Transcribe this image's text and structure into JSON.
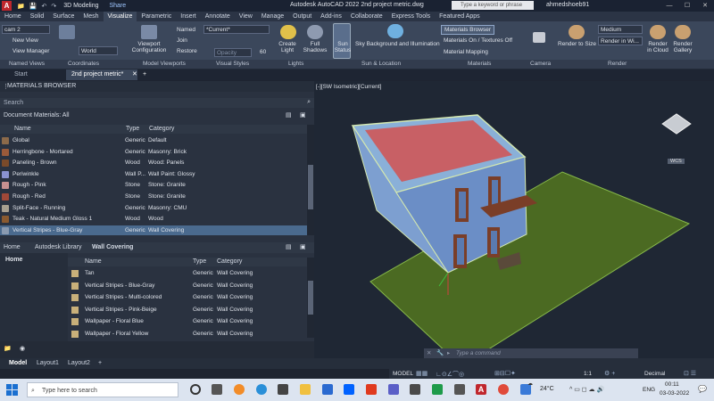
{
  "titlebar": {
    "app_icon": "A",
    "quick_access": [
      "📁",
      "💾",
      "↶",
      "↷"
    ],
    "workspace": "3D Modeling",
    "share": "Share",
    "app_title": "Autodesk AutoCAD 2022     2nd project metric.dwg",
    "search_placeholder": "Type a keyword or phrase",
    "user": "ahmedshoeb91"
  },
  "ribbon_tabs": [
    "Home",
    "Solid",
    "Surface",
    "Mesh",
    "Visualize",
    "Parametric",
    "Insert",
    "Annotate",
    "View",
    "Manage",
    "Output",
    "Add-ins",
    "Collaborate",
    "Express Tools",
    "Featured Apps"
  ],
  "ribbon": {
    "named_views": {
      "select": "cam 2",
      "new": "New View",
      "manager": "View Manager",
      "label": "Named Views"
    },
    "coordinates": {
      "select": "World",
      "label": "Coordinates"
    },
    "model_viewports": {
      "config": "Viewport Configuration",
      "named": "Named",
      "join": "Join",
      "restore": "Restore",
      "label": "Model Viewports"
    },
    "visual_styles": {
      "select": "*Current*",
      "opacity": "Opacity",
      "opacity_value": "60",
      "label": "Visual Styles"
    },
    "lights": {
      "create": "Create Light",
      "shadows": "Full Shadows",
      "sun": "Sun Status",
      "label": "Lights"
    },
    "sun_location": {
      "sky": "Sky Background and Illumination",
      "label": "Sun & Location"
    },
    "materials": {
      "browser": "Materials Browser",
      "on_off": "Materials On / Textures Off",
      "mapping": "Material Mapping",
      "label": "Materials"
    },
    "camera": {
      "label": "Camera"
    },
    "render": {
      "to_size": "Render to Size",
      "quality": "Medium",
      "where": "Render in Wi...",
      "cloud": "Render in Cloud",
      "gallery": "Render Gallery",
      "label": "Render"
    }
  },
  "doc_tabs": {
    "start": "Start",
    "active": "2nd project metric*",
    "add": "+"
  },
  "materials_browser": {
    "title": "MATERIALS BROWSER",
    "search": "Search",
    "doc_label": "Document Materials: All",
    "columns": {
      "name": "Name",
      "type": "Type",
      "category": "Category"
    },
    "doc_rows": [
      {
        "name": "Global",
        "type": "Generic",
        "category": "Default",
        "color": "#8c6a4a"
      },
      {
        "name": "Herringbone - Mortared",
        "type": "Generic",
        "category": "Masonry: Brick",
        "color": "#9a5a3a"
      },
      {
        "name": "Paneling - Brown",
        "type": "Wood",
        "category": "Wood: Panels",
        "color": "#7a4a2a"
      },
      {
        "name": "Periwinkle",
        "type": "Wall P...",
        "category": "Wall Paint: Glossy",
        "color": "#8a92d0"
      },
      {
        "name": "Rough - Pink",
        "type": "Stone",
        "category": "Stone: Granite",
        "color": "#c89090"
      },
      {
        "name": "Rough - Red",
        "type": "Stone",
        "category": "Stone: Granite",
        "color": "#a04838"
      },
      {
        "name": "Split-Face - Running",
        "type": "Generic",
        "category": "Masonry: CMU",
        "color": "#a8a090"
      },
      {
        "name": "Teak - Natural Medium Gloss 1",
        "type": "Wood",
        "category": "Wood",
        "color": "#8a5a30"
      },
      {
        "name": "Vertical Stripes - Blue-Gray",
        "type": "Generic",
        "category": "Wall Covering",
        "color": "#8a9ab0"
      }
    ],
    "library": {
      "home": "Home",
      "autodesk_library": "Autodesk Library",
      "wall_covering": "Wall Covering",
      "tree_home": "Home",
      "columns": {
        "name": "Name",
        "type": "Type",
        "category": "Category"
      },
      "rows": [
        {
          "name": "Tan",
          "type": "Generic",
          "category": "Wall Covering"
        },
        {
          "name": "Vertical Stripes - Blue-Gray",
          "type": "Generic",
          "category": "Wall Covering"
        },
        {
          "name": "Vertical Stripes - Multi-colored",
          "type": "Generic",
          "category": "Wall Covering"
        },
        {
          "name": "Vertical Stripes - Pink-Beige",
          "type": "Generic",
          "category": "Wall Covering"
        },
        {
          "name": "Wallpaper - Floral Blue",
          "type": "Generic",
          "category": "Wall Covering"
        },
        {
          "name": "Wallpaper - Floral Yellow",
          "type": "Generic",
          "category": "Wall Covering"
        }
      ]
    }
  },
  "viewport": {
    "label": "[-][SW Isometric][Current]",
    "wcs": "WCS"
  },
  "command": {
    "placeholder": "Type a command"
  },
  "layouts": {
    "model": "Model",
    "layout1": "Layout1",
    "layout2": "Layout2",
    "add": "+"
  },
  "status": {
    "model": "MODEL",
    "scale": "1:1",
    "units": "Decimal"
  },
  "taskbar": {
    "search": "Type here to search",
    "temp": "24°C",
    "lang": "ENG",
    "time": "00:11",
    "date": "03-03-2022"
  }
}
